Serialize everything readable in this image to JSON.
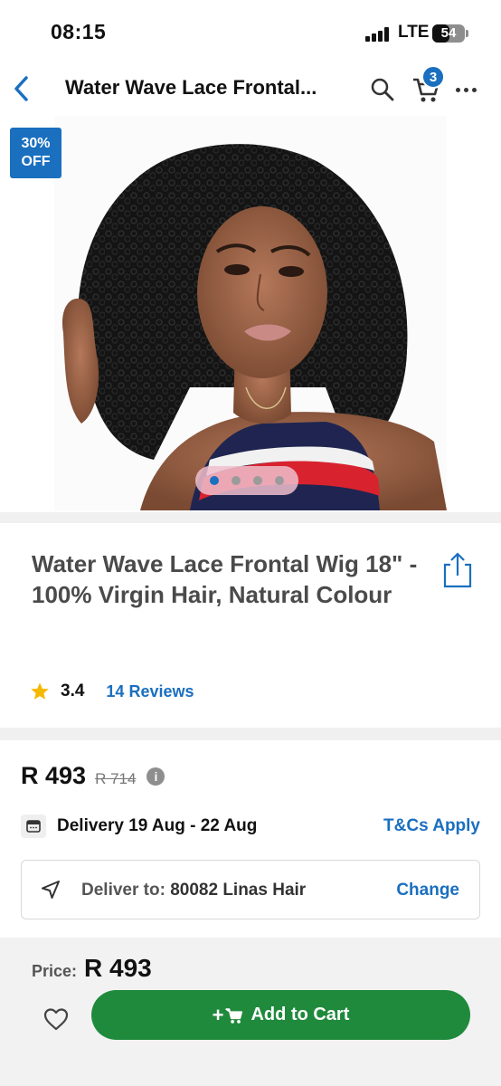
{
  "status_bar": {
    "time": "08:15",
    "network": "LTE",
    "battery": "54",
    "battery_level": 0.54
  },
  "nav": {
    "title": "Water Wave Lace Frontal...",
    "cart_count": "3",
    "icons": [
      "chevron-left-icon",
      "search-icon",
      "cart-icon",
      "more-icon"
    ]
  },
  "hero": {
    "discount_line1": "30%",
    "discount_line2": "OFF",
    "image_count": 4,
    "active_image_index": 0
  },
  "product": {
    "title": "Water Wave Lace Frontal Wig 18\" - 100% Virgin Hair, Natural Colour",
    "rating": "3.4",
    "reviews": "14 Reviews"
  },
  "pricing": {
    "current_price": "R 493",
    "original_price": "R 714",
    "info_glyph": "i",
    "delivery_text": "Delivery 19 Aug - 22 Aug",
    "tcs_link": "T&Cs Apply",
    "deliver_to_label": "Deliver to:",
    "deliver_to_value": "80082 Linas Hair",
    "change_link": "Change"
  },
  "bottom_bar": {
    "price_label": "Price:",
    "price_value": "R 493",
    "plus_glyph": "+",
    "add_to_cart_label": "Add to Cart"
  },
  "colors": {
    "accent_blue": "#1a6fbf",
    "cta_green": "#1f8a3c",
    "star_yellow": "#f5b800"
  }
}
